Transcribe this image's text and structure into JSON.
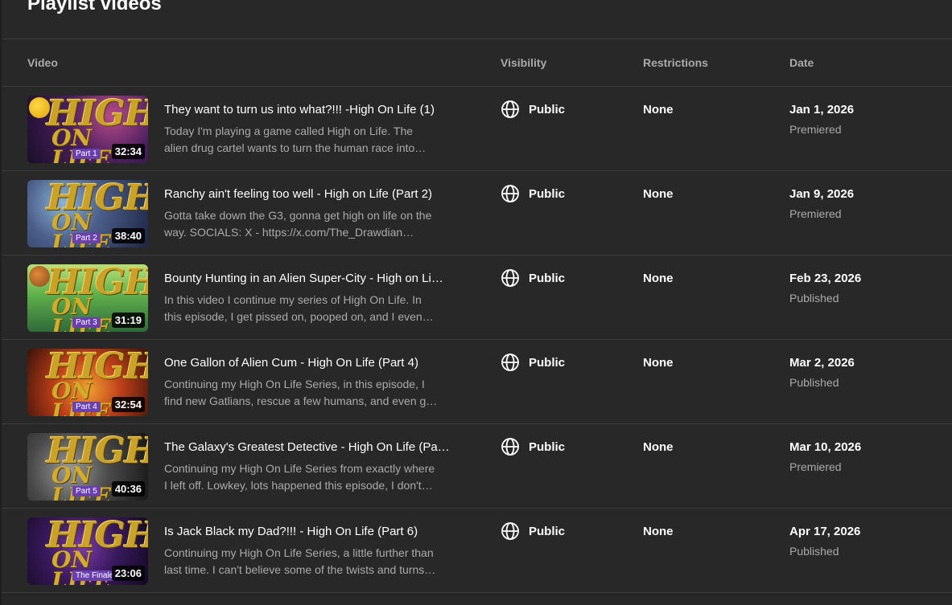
{
  "page": {
    "title": "Playlist videos"
  },
  "columns": {
    "video": "Video",
    "visibility": "Visibility",
    "restrictions": "Restrictions",
    "date": "Date"
  },
  "colors": {
    "background": "#282828",
    "divider": "#3d3d3d",
    "secondary_text": "#aaaaaa",
    "primary_text": "#ffffff"
  },
  "videos": [
    {
      "title": "They want to turn us into what?!!! -High On Life (1)",
      "desc1": "Today I'm playing a game called High on Life. The",
      "desc2": "alien drug cartel wants to turn the human race into…",
      "duration": "32:34",
      "thumb_part": "Part 1",
      "thumb_logo": "HIGH",
      "thumb_logo2": "ON LIFE",
      "visibility": "Public",
      "visibility_icon": "globe-icon",
      "restrictions": "None",
      "date": "Jan 1, 2026",
      "date_status": "Premiered"
    },
    {
      "title": "Ranchy ain't feeling too well - High on Life (Part 2)",
      "desc1": "Gotta take down the G3, gonna get high on life on the",
      "desc2": "way. SOCIALS: X - https://x.com/The_Drawdian…",
      "duration": "38:40",
      "thumb_part": "Part 2",
      "thumb_logo": "HIGH",
      "thumb_logo2": "ON LIFE",
      "visibility": "Public",
      "visibility_icon": "globe-icon",
      "restrictions": "None",
      "date": "Jan 9, 2026",
      "date_status": "Premiered"
    },
    {
      "title": "Bounty Hunting in an Alien Super-City - High on Li…",
      "desc1": "In this video I continue my series of High On Life. In",
      "desc2": "this episode, I get pissed on, pooped on, and I even…",
      "duration": "31:19",
      "thumb_part": "Part 3",
      "thumb_logo": "HIGH",
      "thumb_logo2": "ON LIFE",
      "visibility": "Public",
      "visibility_icon": "globe-icon",
      "restrictions": "None",
      "date": "Feb 23, 2026",
      "date_status": "Published"
    },
    {
      "title": "One Gallon of Alien Cum - High On Life (Part 4)",
      "desc1": "Continuing my High On Life Series, in this episode, I",
      "desc2": "find new Gatlians, rescue a few humans, and even g…",
      "duration": "32:54",
      "thumb_part": "Part 4",
      "thumb_logo": "HIGH",
      "thumb_logo2": "ON LIFE",
      "visibility": "Public",
      "visibility_icon": "globe-icon",
      "restrictions": "None",
      "date": "Mar 2, 2026",
      "date_status": "Published"
    },
    {
      "title": "The Galaxy's Greatest Detective - High On Life (Pa…",
      "desc1": "Continuing my High On Life Series from exactly where",
      "desc2": "I left off. Lowkey, lots happened this episode, I don't…",
      "duration": "40:36",
      "thumb_part": "Part 5",
      "thumb_logo": "HIGH",
      "thumb_logo2": "ON LIFE",
      "visibility": "Public",
      "visibility_icon": "globe-icon",
      "restrictions": "None",
      "date": "Mar 10, 2026",
      "date_status": "Premiered"
    },
    {
      "title": "Is Jack Black my Dad?!!! - High On Life (Part 6)",
      "desc1": "Continuing my High On Life Series, a little further than",
      "desc2": "last time. I can't believe some of the twists and turns…",
      "duration": "23:06",
      "thumb_part": "The Finale",
      "thumb_logo": "HIGH",
      "thumb_logo2": "ON LIFE",
      "visibility": "Public",
      "visibility_icon": "globe-icon",
      "restrictions": "None",
      "date": "Apr 17, 2026",
      "date_status": "Published"
    }
  ]
}
